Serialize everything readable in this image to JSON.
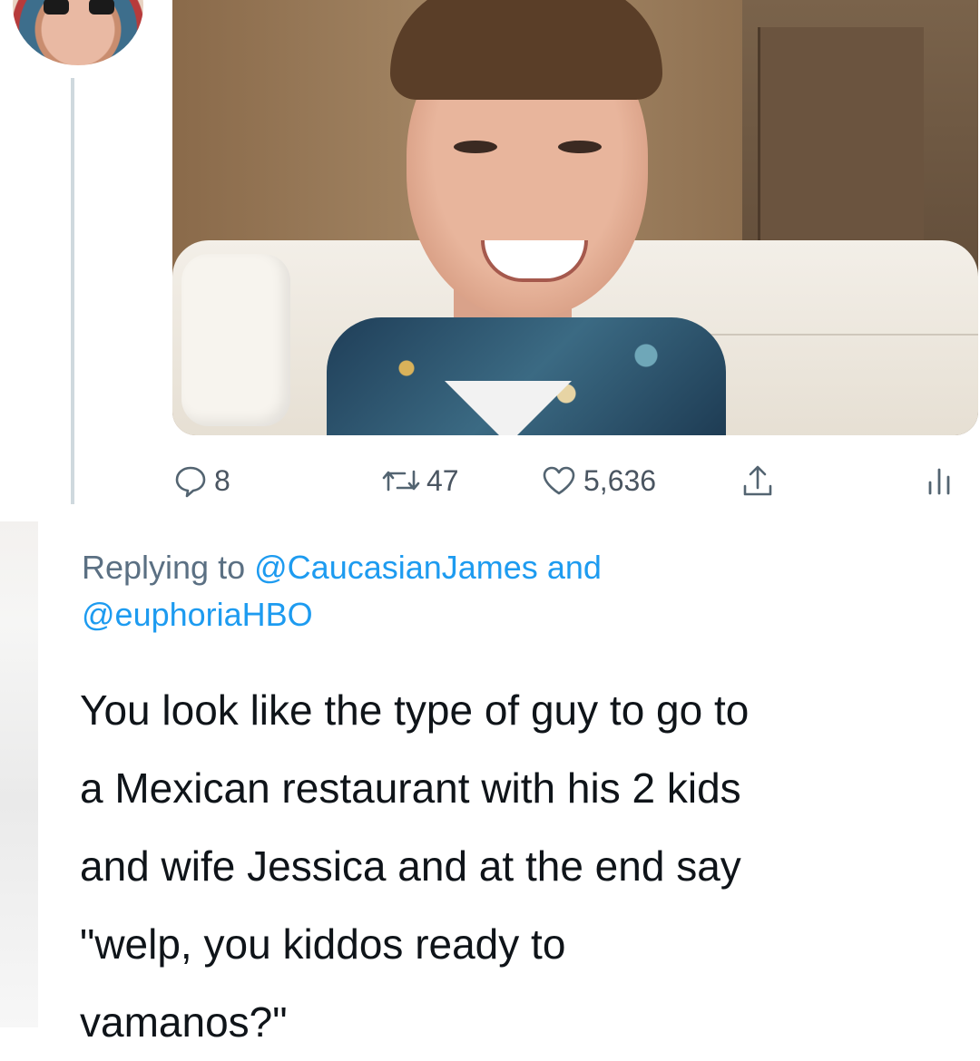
{
  "tweet": {
    "stats": {
      "replies": "8",
      "retweets": "47",
      "likes": "5,636"
    },
    "icons": {
      "reply": "reply-icon",
      "retweet": "retweet-icon",
      "like": "heart-icon",
      "share": "share-icon",
      "analytics": "analytics-icon"
    }
  },
  "reply": {
    "replying_prefix": "Replying to",
    "mention_1": "@CaucasianJames",
    "conjunction": "and",
    "mention_2": "@euphoriaHBO",
    "text_lines": [
      "You look like the type of guy to go to",
      "a Mexican restaurant with his 2 kids",
      "and wife Jessica and at the end say",
      "\"welp, you kiddos ready to",
      "vamanos?\""
    ]
  },
  "colors": {
    "link": "#1d9bf0",
    "muted": "#536471",
    "text": "#0f1419"
  }
}
